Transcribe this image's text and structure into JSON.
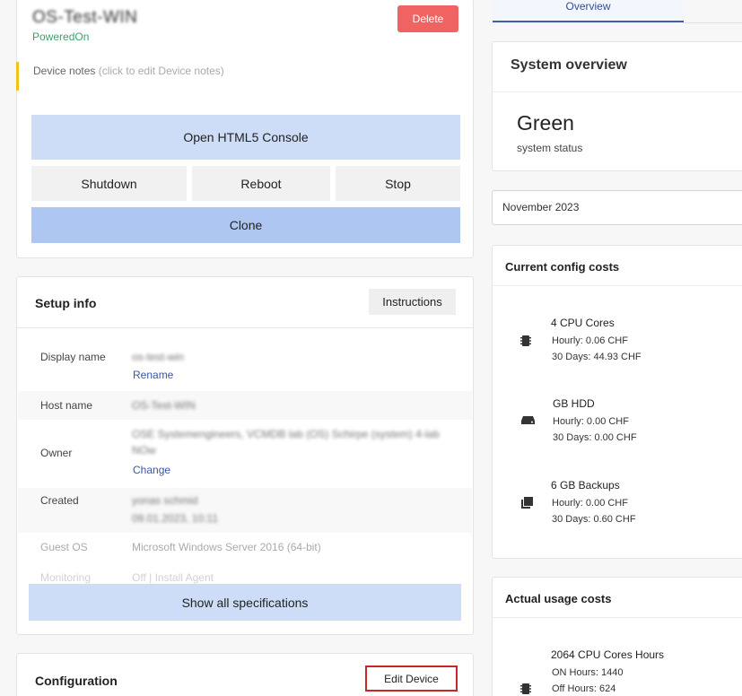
{
  "device": {
    "name": "OS-Test-WIN",
    "state": "PoweredOn",
    "delete_label": "Delete",
    "notes_label": "Device notes",
    "notes_hint": "(click to edit Device notes)",
    "console_label": "Open HTML5 Console",
    "shutdown_label": "Shutdown",
    "reboot_label": "Reboot",
    "stop_label": "Stop",
    "clone_label": "Clone"
  },
  "setup": {
    "title": "Setup info",
    "instructions_label": "Instructions",
    "display_name_label": "Display name",
    "display_name_value": "os-test-win",
    "rename_label": "Rename",
    "host_name_label": "Host name",
    "host_name_value": "OS-Test-WIN",
    "owner_label": "Owner",
    "owner_value": "OSE Systemengineers, VCMDB lab (OS) Schirpe (system) 4-lab",
    "owner_value2": "NOw",
    "change_label": "Change",
    "created_label": "Created",
    "created_value": "yonas schmid",
    "created_value2": "09.01.2023, 10:11",
    "guest_os_label": "Guest OS",
    "guest_os_value": "Microsoft Windows Server 2016 (64-bit)",
    "monitoring_label": "Monitoring",
    "monitoring_value": "Off | Install Agent",
    "show_specs_label": "Show all specifications"
  },
  "configuration": {
    "title": "Configuration",
    "edit_label": "Edit Device"
  },
  "tabs": {
    "overview": "Overview"
  },
  "overview": {
    "title": "System overview",
    "status": "Green",
    "status_caption": "system status"
  },
  "month": "November 2023",
  "config_costs": {
    "title": "Current config costs",
    "items": [
      {
        "icon": "cpu-icon",
        "name": "4 CPU Cores",
        "line1": "Hourly: 0.06 CHF",
        "line2": "30 Days: 44.93 CHF"
      },
      {
        "icon": "hdd-icon",
        "name": "GB HDD",
        "line1": "Hourly: 0.00 CHF",
        "line2": "30 Days: 0.00 CHF"
      },
      {
        "icon": "backup-icon",
        "name": "6 GB Backups",
        "line1": "Hourly: 0.00 CHF",
        "line2": "30 Days: 0.60 CHF"
      }
    ]
  },
  "usage_costs": {
    "title": "Actual usage costs",
    "items": [
      {
        "icon": "cpu-icon",
        "name": "2064 CPU Cores Hours",
        "line1": "ON Hours: 1440",
        "line2": "Off Hours: 624"
      }
    ]
  }
}
